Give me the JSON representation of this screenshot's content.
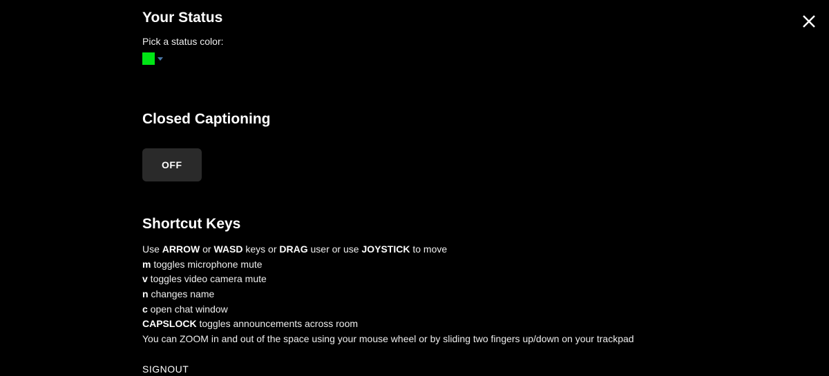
{
  "status": {
    "title": "Your Status",
    "pickLabel": "Pick a status color:",
    "swatchColor": "#00e515"
  },
  "cc": {
    "title": "Closed Captioning",
    "toggleLabel": "OFF"
  },
  "shortcuts": {
    "title": "Shortcut Keys",
    "lines": [
      {
        "b1": "ARROW",
        "b2": "WASD",
        "b3": "DRAG",
        "b4": "JOYSTICK",
        "pre": "Use ",
        "mid1": " or ",
        "mid2": " keys or ",
        "mid3": " user or use ",
        "post": " to move"
      },
      {
        "key": "m",
        "desc": " toggles microphone mute"
      },
      {
        "key": "v",
        "desc": " toggles video camera mute"
      },
      {
        "key": "n",
        "desc": " changes name"
      },
      {
        "key": "c",
        "desc": " open chat window"
      },
      {
        "key": "CAPSLOCK",
        "desc": " toggles announcements across room"
      },
      {
        "text": "You can ZOOM in and out of the space using your mouse wheel or by sliding two fingers up/down on your trackpad"
      }
    ]
  },
  "signout": "SIGNOUT"
}
